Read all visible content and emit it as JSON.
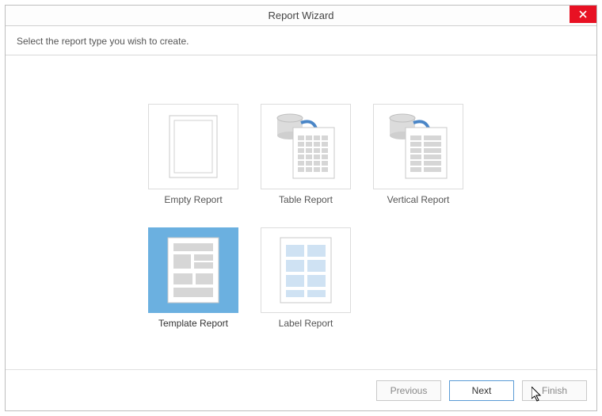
{
  "window": {
    "title": "Report Wizard"
  },
  "prompt": "Select the report type you wish to create.",
  "options": {
    "empty": "Empty Report",
    "table": "Table Report",
    "vertical": "Vertical Report",
    "template": "Template Report",
    "label": "Label Report"
  },
  "selected": "template",
  "buttons": {
    "previous": "Previous",
    "next": "Next",
    "finish": "Finish"
  }
}
